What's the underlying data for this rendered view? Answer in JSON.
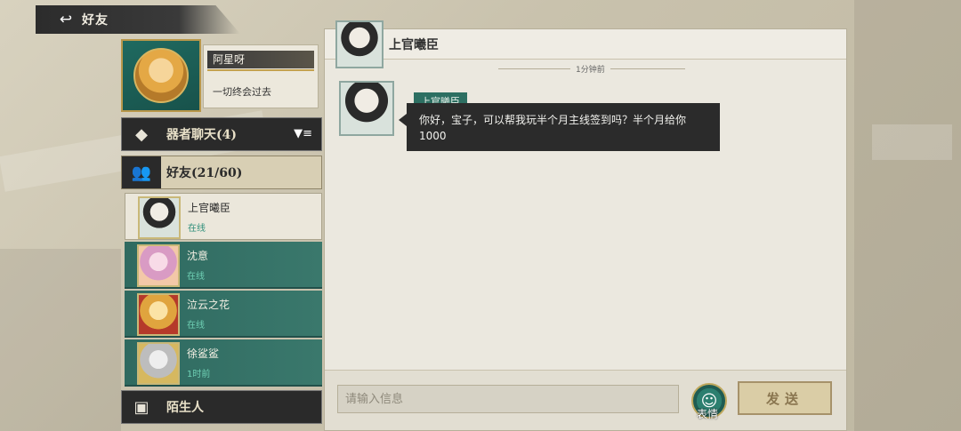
{
  "header": {
    "title": "好友"
  },
  "profile": {
    "name": "阿星呀",
    "motto": "一切终会过去"
  },
  "sections": {
    "chat": {
      "label": "器者聊天(4)"
    },
    "friends": {
      "label": "好友(21/60)"
    },
    "strangers": {
      "label": "陌生人"
    }
  },
  "friends": [
    {
      "name": "上官曦臣",
      "status": "在线",
      "selected": true
    },
    {
      "name": "沈意",
      "status": "在线"
    },
    {
      "name": "泣云之花",
      "status": "在线"
    },
    {
      "name": "徐鲨鲨",
      "status": "1时前"
    }
  ],
  "chat": {
    "title": "上官曦臣",
    "timestamp": "1分钟前",
    "message": {
      "sender": "上官曦臣",
      "text": "你好，宝子，可以帮我玩半个月主线签到吗？半个月给你1000"
    },
    "input_placeholder": "请输入信息",
    "emoji_label": "表情",
    "send_label": "发送"
  }
}
